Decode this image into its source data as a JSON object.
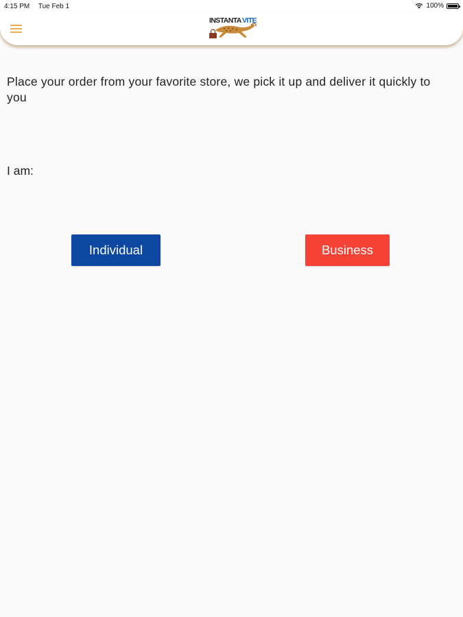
{
  "status_bar": {
    "time": "4:15 PM",
    "date": "Tue Feb 1",
    "battery_text": "100%",
    "battery_level": 1.0,
    "icons": [
      "wifi-icon",
      "battery-icon"
    ]
  },
  "header": {
    "logo_text_left": "INSTANTA",
    "logo_text_right": "VITE",
    "menu_icon": "hamburger-menu-icon",
    "menu_color": "#e8a13a"
  },
  "main": {
    "tagline": "Place your order from your favorite store, we pick it up and deliver it quickly to you",
    "iam_label": "I am:"
  },
  "buttons": {
    "individual": {
      "label": "Individual",
      "color": "#0d47a1"
    },
    "business": {
      "label": "Business",
      "color": "#f44336"
    }
  },
  "colors": {
    "background": "#fafafa",
    "header_shadow": "#a0783c",
    "logo_blue": "#1565c0",
    "logo_brown": "#b8772e"
  }
}
